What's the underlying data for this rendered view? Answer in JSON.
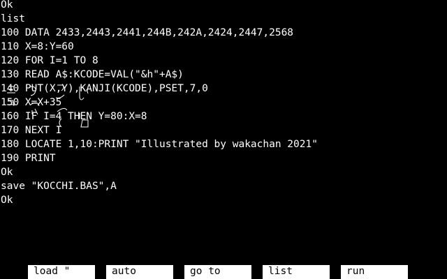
{
  "terminal": {
    "lines": [
      "Ok",
      "list",
      "100 DATA 2433,2443,2441,244B,242A,2424,2447,2568",
      "110 X=8:Y=60",
      "120 FOR I=1 TO 8",
      "130 READ A$:KCODE=VAL(\"&h\"+A$)",
      "140 PUT(X,Y),KANJI(KCODE),PSET,7,0",
      "150 X=X+35",
      "160 IF I=4 THEN Y=80:X=8",
      "170 NEXT I",
      "180 LOCATE 1,10:PRINT \"Illustrated by wakachan 2021\"",
      "190 PRINT",
      "Ok",
      "save \"KOCCHI.BAS\",A",
      "Ok"
    ]
  },
  "function_keys": [
    {
      "label": "load \""
    },
    {
      "label": "auto"
    },
    {
      "label": "go to"
    },
    {
      "label": "list"
    },
    {
      "label": "run"
    }
  ],
  "colors": {
    "background": "#000000",
    "text": "#ffffff",
    "key_bg": "#ffffff",
    "key_text": "#000000"
  }
}
